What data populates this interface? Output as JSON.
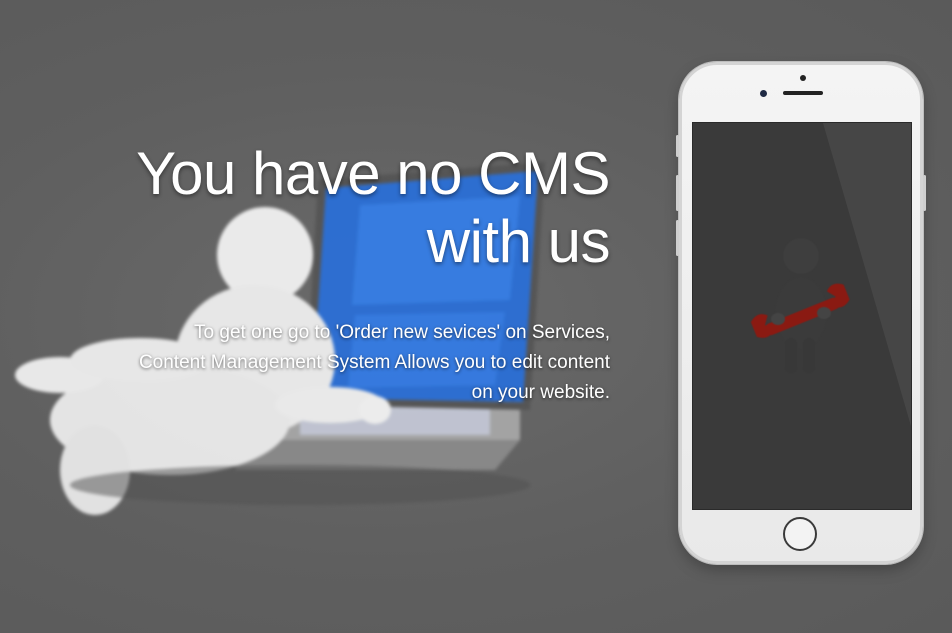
{
  "hero": {
    "title_line1": "You have no CMS",
    "title_line2": "with us",
    "description_line1": "To get one go to 'Order new sevices' on Services,",
    "description_line2": "Content Management System Allows you to edit content",
    "description_line3": "on your website."
  },
  "illustration": {
    "icon": "person-with-laptop-icon"
  },
  "phone": {
    "icon": "person-with-wrench-icon"
  },
  "colors": {
    "background": "#5e5e5e",
    "text": "#ffffff",
    "screen": "#3a3a3a",
    "wrench": "#8a1a12",
    "laptop_screen": "#2b6fd6"
  }
}
